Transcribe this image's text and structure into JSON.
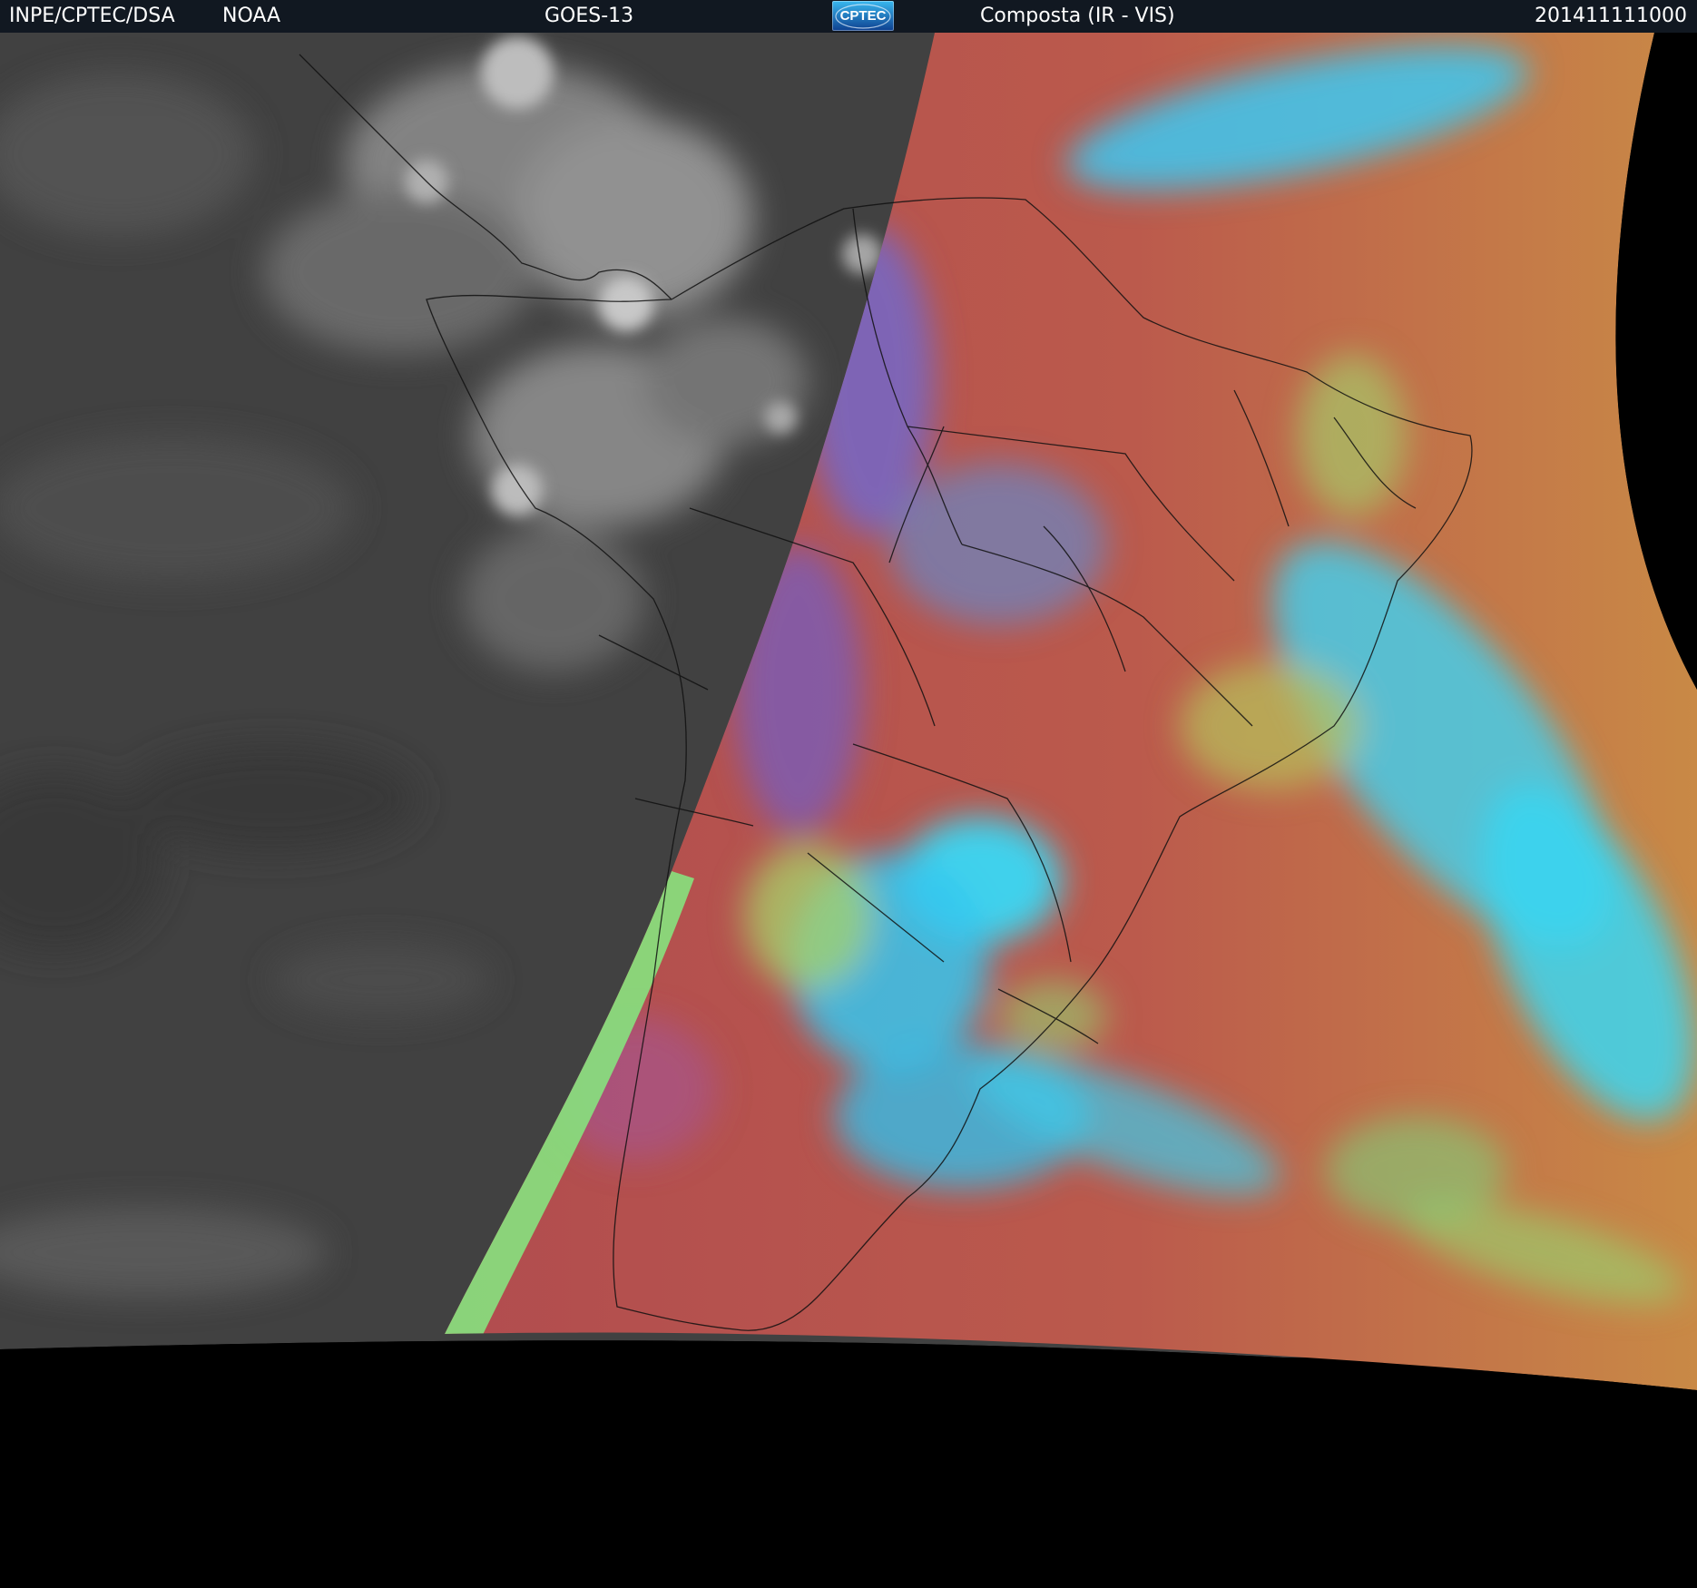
{
  "header": {
    "agency": "INPE/CPTEC/DSA",
    "partner": "NOAA",
    "satellite": "GOES-13",
    "logo_text": "CPTEC",
    "product": "Composta (IR - VIS)",
    "timestamp": "201411111000"
  },
  "colors": {
    "header_bg": "#111821",
    "ir_gray": "#444444",
    "composite_red": "#b04a4d",
    "composite_orange": "#c9774a",
    "cloud_cyan": "#39d6f2",
    "cloud_green": "#8fe07a",
    "background": "#000000"
  }
}
